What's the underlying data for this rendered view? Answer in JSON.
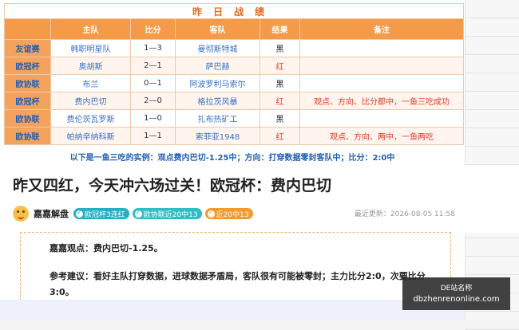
{
  "results_table": {
    "title": "昨日战绩",
    "headers": [
      "",
      "主队",
      "比分",
      "客队",
      "结果",
      "备注"
    ],
    "rows": [
      {
        "league": "友谊赛",
        "home": "韩职明星队",
        "score": "1—3",
        "away": "曼彻斯特城",
        "result": "黑",
        "note": ""
      },
      {
        "league": "欧冠杯",
        "home": "奥胡斯",
        "score": "2—1",
        "away": "萨巴赫",
        "result": "红",
        "note": ""
      },
      {
        "league": "欧协联",
        "home": "布兰",
        "score": "0—1",
        "away": "阿波罗利马索尔",
        "result": "黑",
        "note": ""
      },
      {
        "league": "欧冠杯",
        "home": "费内巴切",
        "score": "2—0",
        "away": "格拉茨风暴",
        "result": "红",
        "note": "观点、方向、比分都中，一鱼三吃成功"
      },
      {
        "league": "欧协联",
        "home": "费伦茨瓦罗斯",
        "score": "1—0",
        "away": "扎布热矿工",
        "result": "黑",
        "note": ""
      },
      {
        "league": "欧协联",
        "home": "帕纳辛纳科斯",
        "score": "1—1",
        "away": "索菲亚1948",
        "result": "红",
        "note": "观点、方向、两中，一鱼两吃"
      }
    ],
    "example_line": "以下是一鱼三吃的实例：观点费内巴切-1.25中；方向：打穿数据零封客队中；比分：2:0中"
  },
  "article": {
    "title": "昨又四红，今天冲六场过关！欧冠杯：费内巴切",
    "author": "嘉嘉解盘",
    "badges": [
      "欧冠杯3连红",
      "欧协联近20中13",
      "近20中13"
    ],
    "updated": "最近更新：2026-08-05 11:58",
    "viewpoint": "嘉嘉观点：费内巴切-1.25。",
    "suggestion": "参考建议：看好主队打穿数据，进球数据矛盾局，客队很有可能被零封；主力比分2:0，次要比分3:0。"
  },
  "watermark": {
    "label": "DE站名称",
    "url": "dbzhenrenonline.com"
  },
  "colors": {
    "header_orange": "#f49a48",
    "title_orange": "#e8691f",
    "win_red": "#e23a2c",
    "link_blue": "#1f5fb5"
  },
  "icons": {
    "avatar": "smiley-face-avatar",
    "badge_check": "check-circle-icon"
  }
}
